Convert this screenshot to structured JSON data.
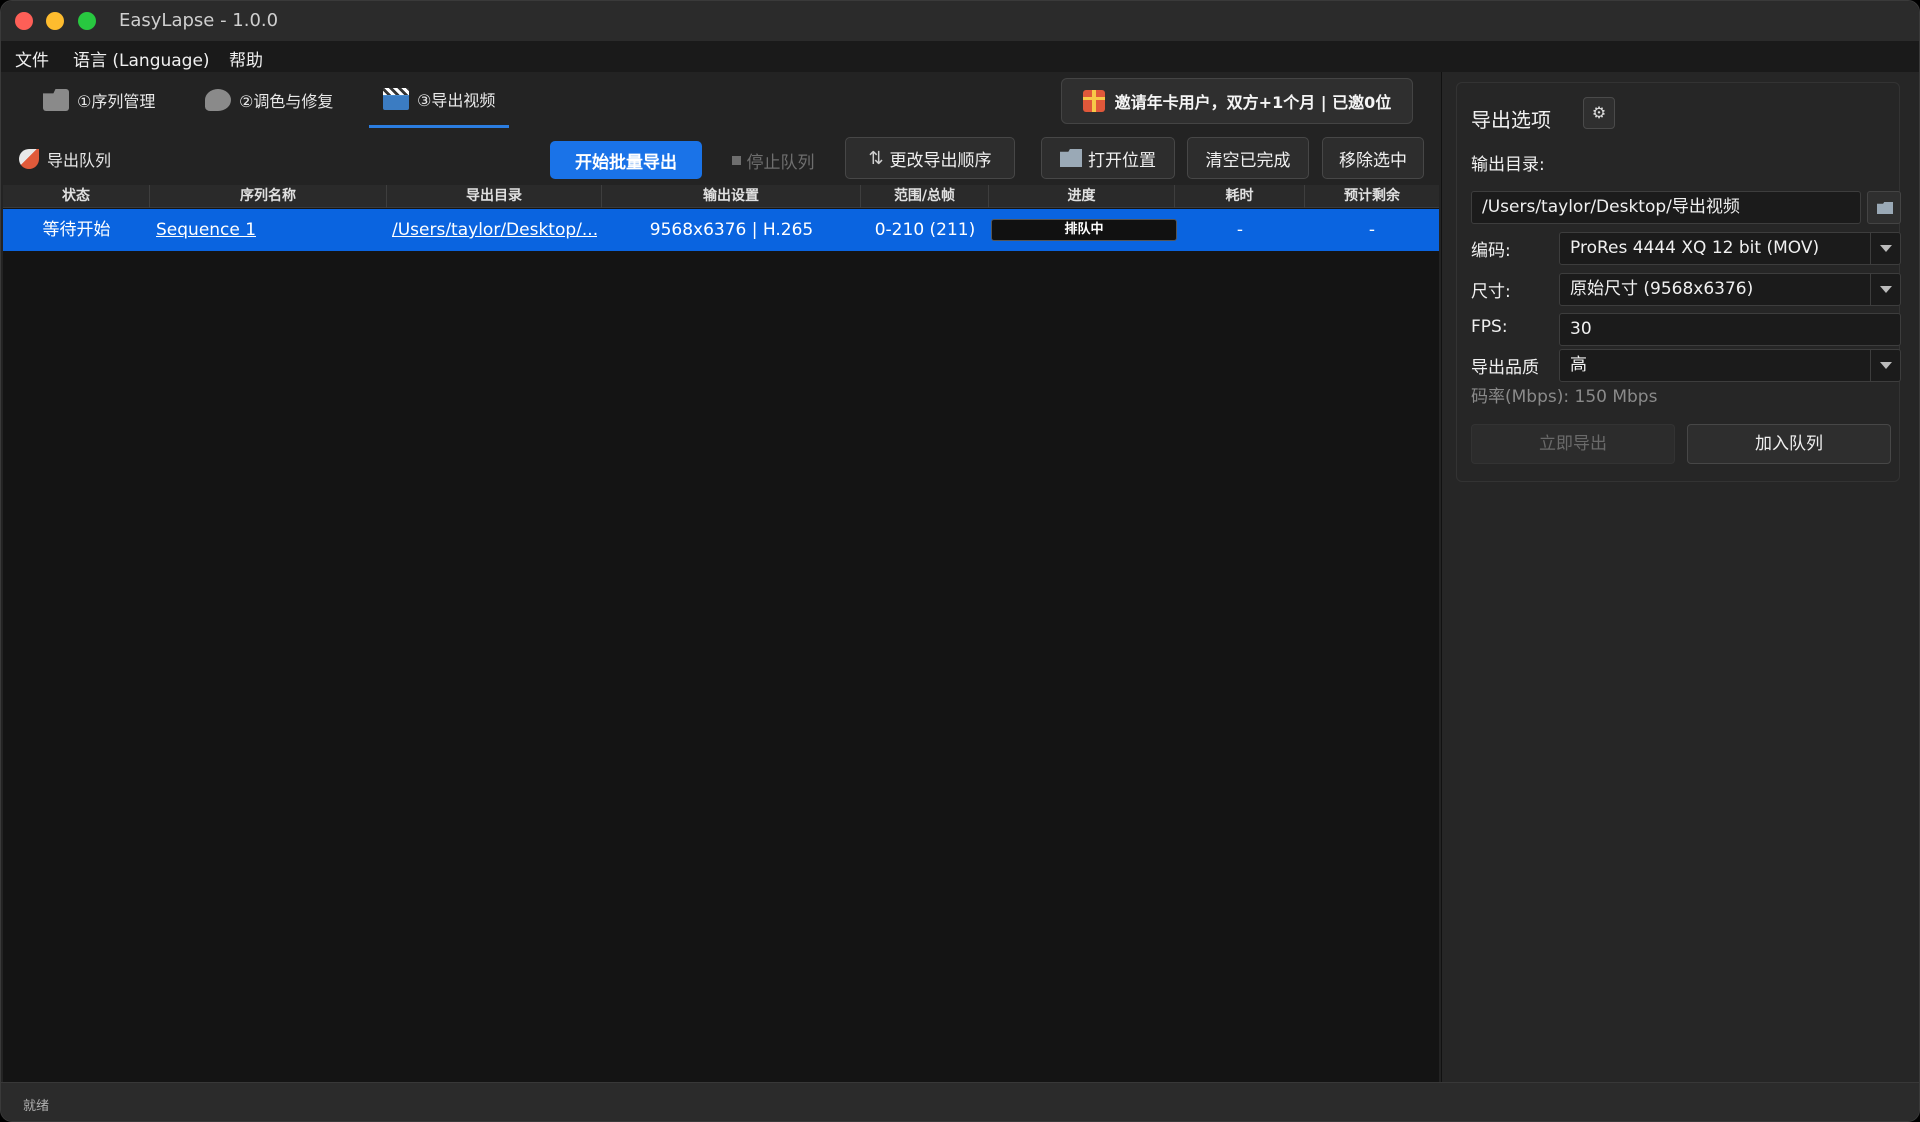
{
  "window": {
    "title": "EasyLapse - 1.0.0"
  },
  "menu": [
    "文件",
    "语言 (Language)",
    "帮助"
  ],
  "tabs": [
    {
      "label": "①序列管理",
      "icon": "folder-icon"
    },
    {
      "label": "②调色与修复",
      "icon": "palette-icon"
    },
    {
      "label": "③导出视频",
      "icon": "clapperboard-icon",
      "active": true
    }
  ],
  "promo": {
    "label": "邀请年卡用户，双方+1个月 | 已邀0位",
    "icon": "gift-icon"
  },
  "toolbar": {
    "queue_label": "导出队列",
    "start_batch": "开始批量导出",
    "stop_queue": "停止队列",
    "change_order": "更改导出顺序",
    "open_location": "打开位置",
    "clear_done": "清空已完成",
    "remove_selected": "移除选中"
  },
  "table": {
    "columns": [
      "状态",
      "序列名称",
      "导出目录",
      "输出设置",
      "范围/总帧",
      "进度",
      "耗时",
      "预计剩余"
    ],
    "rows": [
      {
        "status": "等待开始",
        "name": "Sequence 1",
        "dir": "/Users/taylor/Desktop/...",
        "settings": "9568x6376 | H.265",
        "range": "0-210 (211)",
        "progress": "排队中",
        "elapsed": "-",
        "remaining": "-"
      }
    ]
  },
  "export_options": {
    "title": "导出选项",
    "output_dir_label": "输出目录:",
    "output_dir_value": "/Users/taylor/Desktop/导出视频",
    "codec_label": "编码:",
    "codec_value": "ProRes 4444 XQ 12 bit (MOV)",
    "size_label": "尺寸:",
    "size_value": "原始尺寸 (9568x6376)",
    "fps_label": "FPS:",
    "fps_value": "30",
    "quality_label": "导出品质",
    "quality_value": "高",
    "bitrate": "码率(Mbps): 150 Mbps",
    "export_now": "立即导出",
    "add_to_queue": "加入队列"
  },
  "status": {
    "text": "就绪"
  },
  "colors": {
    "accent": "#1a73e8",
    "selected_row": "#0a64e0"
  }
}
